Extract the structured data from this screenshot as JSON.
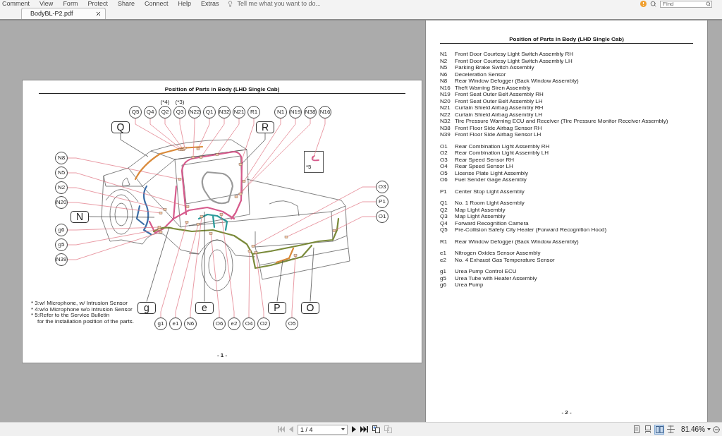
{
  "menu_bar": {
    "items": [
      "Comment",
      "View",
      "Form",
      "Protect",
      "Share",
      "Connect",
      "Help",
      "Extras"
    ],
    "tell_me": {
      "placeholder": "Tell me what you want to do..."
    },
    "find": {
      "placeholder": "Find"
    }
  },
  "tabs": [
    {
      "label": "BodyBL-P2.pdf",
      "selected": true
    }
  ],
  "page_1": {
    "title": "Position of Parts in Body (LHD Single Cab)",
    "callouts": [
      {
        "label": "Q5"
      },
      {
        "label": "Q4"
      },
      {
        "label": "Q2",
        "note": "(*4)"
      },
      {
        "label": "Q3",
        "note": "(*3)"
      },
      {
        "label": "N22"
      },
      {
        "label": "Q1"
      },
      {
        "label": "N32"
      },
      {
        "label": "N21"
      },
      {
        "label": "R1"
      },
      {
        "label": "N1"
      },
      {
        "label": "N19"
      },
      {
        "label": "N38"
      },
      {
        "label": "N16"
      },
      {
        "label": "N8"
      },
      {
        "label": "N5"
      },
      {
        "label": "N2"
      },
      {
        "label": "N20"
      },
      {
        "label": "g6"
      },
      {
        "label": "g5"
      },
      {
        "label": "N39"
      },
      {
        "label": "O3"
      },
      {
        "label": "P1"
      },
      {
        "label": "O1"
      },
      {
        "label": "g1"
      },
      {
        "label": "e1"
      },
      {
        "label": "N6"
      },
      {
        "label": "O6"
      },
      {
        "label": "e2"
      },
      {
        "label": "O4"
      },
      {
        "label": "O2"
      },
      {
        "label": "O5"
      }
    ],
    "group_labels": [
      "Q",
      "R",
      "N",
      "g",
      "e",
      "P",
      "O"
    ],
    "inset_note": "*5",
    "footnotes": [
      {
        "text": "* 3:w/ Microphone, w/ Intrusion Sensor"
      },
      {
        "text": "* 4:w/o Microphone w/o Intrusion Sensor"
      },
      {
        "text": "* 5:Refer to the Service Bulletin",
        "continuation": "for the installation position of the parts."
      }
    ],
    "page_number": "- 1 -"
  },
  "page_2": {
    "title": "Position of Parts in Body (LHD Single Cab)",
    "groups": [
      [
        {
          "code": "N1",
          "name": "Front Door Courtesy Light Switch Assembly RH"
        },
        {
          "code": "N2",
          "name": "Front Door Courtesy Light Switch Assembly LH"
        },
        {
          "code": "N5",
          "name": "Parking Brake Switch Assembly"
        },
        {
          "code": "N6",
          "name": "Deceleration Sensor"
        },
        {
          "code": "N8",
          "name": "Rear Window Defogger (Back Window Assembly)"
        },
        {
          "code": "N16",
          "name": "Theft Warning Siren Assembly"
        },
        {
          "code": "N19",
          "name": "Front Seat Outer Belt Assembly RH"
        },
        {
          "code": "N20",
          "name": "Front Seat Outer Belt Assembly LH"
        },
        {
          "code": "N21",
          "name": "Curtain Shield Airbag Assembly RH"
        },
        {
          "code": "N22",
          "name": "Curtain Shield Airbag Assembly LH"
        },
        {
          "code": "N32",
          "name": "Tire Pressure Warning ECU and Receiver (Tire Pressure Monitor Receiver Assembly)"
        },
        {
          "code": "N38",
          "name": "Front Floor Side Airbag Sensor RH"
        },
        {
          "code": "N39",
          "name": "Front Floor Side Airbag Sensor LH"
        }
      ],
      [
        {
          "code": "O1",
          "name": "Rear Combination Light Assembly RH"
        },
        {
          "code": "O2",
          "name": "Rear Combination Light Assembly LH"
        },
        {
          "code": "O3",
          "name": "Rear Speed Sensor RH"
        },
        {
          "code": "O4",
          "name": "Rear Speed Sensor LH"
        },
        {
          "code": "O5",
          "name": "License Plate Light Assembly"
        },
        {
          "code": "O6",
          "name": "Fuel Sender Gage Assembly"
        }
      ],
      [
        {
          "code": "P1",
          "name": "Center Stop Light Assembly"
        }
      ],
      [
        {
          "code": "Q1",
          "name": "No. 1 Room Light Assembly"
        },
        {
          "code": "Q2",
          "name": "Map Light Assembly"
        },
        {
          "code": "Q3",
          "name": "Map Light Assembly"
        },
        {
          "code": "Q4",
          "name": "Forward Recognition Camera"
        },
        {
          "code": "Q5",
          "name": "Pre-Collision Safety City Heater (Forward Recognition Hood)"
        }
      ],
      [
        {
          "code": "R1",
          "name": "Rear Window Defogger (Back Window Assembly)"
        }
      ],
      [
        {
          "code": "e1",
          "name": "Nitrogen Oxides Sensor Assembly"
        },
        {
          "code": "e2",
          "name": "No. 4 Exhaust Gas Temperature Sensor"
        }
      ],
      [
        {
          "code": "g1",
          "name": "Urea Pump Control ECU"
        },
        {
          "code": "g5",
          "name": "Urea Tube with Heater Assembly"
        },
        {
          "code": "g6",
          "name": "Urea Pump"
        }
      ]
    ],
    "page_number": "- 2 -"
  },
  "status_bar": {
    "page_nav": [
      {
        "kind": "first",
        "disabled": true
      },
      {
        "kind": "previous",
        "disabled": true
      },
      {
        "kind": "next",
        "disabled": false
      },
      {
        "kind": "last",
        "disabled": false
      }
    ],
    "page_field": {
      "value": "1 / 4"
    },
    "page_tools": [
      {
        "kind": "insert",
        "disabled": false
      },
      {
        "kind": "extract",
        "disabled": true
      }
    ],
    "view_modes": [
      {
        "kind": "single",
        "selected": false
      },
      {
        "kind": "continuous",
        "selected": false
      },
      {
        "kind": "facing",
        "selected": true
      },
      {
        "kind": "continuous_facing",
        "selected": false
      }
    ],
    "zoom": {
      "value": "81.46%"
    }
  }
}
